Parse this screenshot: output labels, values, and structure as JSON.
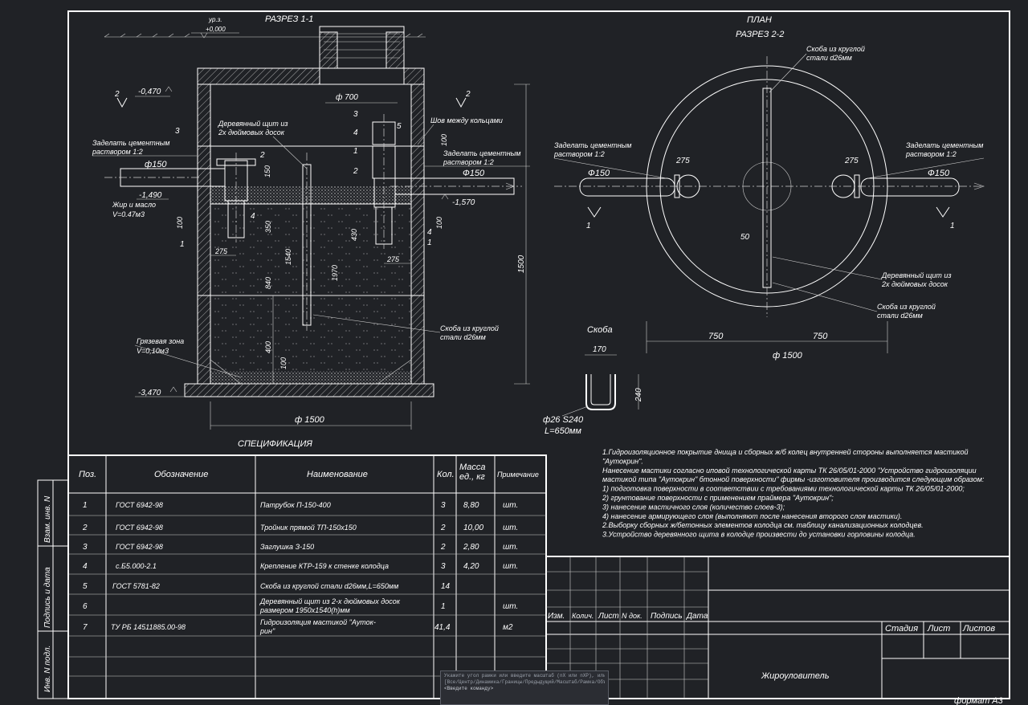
{
  "drawing": {
    "section_1_title": "РАЗРЕЗ 1-1",
    "plan_title": "ПЛАН",
    "plan_subtitle": "РАЗРЕЗ 2-2",
    "spec_title": "СПЕЦИФИКАЦИЯ",
    "clip_title": "Скоба",
    "ground_level_label": "ур.з.",
    "ground_level_value": "+0,000",
    "section1_left": {
      "mark_minus_470": "-0,470",
      "section_marker_2": "2",
      "label_3": "3",
      "cement_note": "Заделать цементным\nраствором 1:2",
      "label_2": "2",
      "dim_150": "150",
      "pipe_d150": "ф150",
      "mark_minus_1490": "-1,490",
      "grease_note": "Жир и масло",
      "grease_volume": "V=0.47м3",
      "label_4": "4",
      "dim_100": "100",
      "dim_350": "350",
      "label_1": "1",
      "dim_275": "275",
      "dim_840": "840",
      "dim_1540": "1540",
      "dim_400": "400",
      "dim_100b": "100",
      "mud_zone": "Грязевая зона",
      "mud_volume": "V=0,10м3",
      "mark_minus_3470": "-3,470",
      "dim_d1500": "ф 1500",
      "wood_shield": "Деревянный щит из\n2х дюймовых досок",
      "dim_d700": "ф 700"
    },
    "section1_right": {
      "label_3": "3",
      "label_5": "5",
      "label_4": "4",
      "label_1": "1",
      "label_2": "2",
      "section_marker_2": "2",
      "ring_seam": "Шов между кольцами",
      "dim_100": "100",
      "cement_note": "Заделать цементным\nраствором 1:2",
      "pipe_d150": "Ф150",
      "mark_minus_1570": "-1,570",
      "dim_430": "430",
      "dim_1970": "1970",
      "dim_100b": "100",
      "label_4b": "4",
      "label_1b": "1",
      "dim_275": "275",
      "dim_1500": "1500",
      "clip_note": "Скоба из круглой\nстали d26мм"
    },
    "plan": {
      "clip_note_top": "Скоба из круглой\nстали d26мм",
      "cement_left": "Заделать цементным\nраствором 1:2",
      "cement_right": "Заделать цементным\nраствором 1:2",
      "dim_275_left": "275",
      "dim_275_right": "275",
      "pipe_left": "Ф150",
      "pipe_right": "Ф150",
      "marker_1_left": "1",
      "marker_1_right": "1",
      "dim_50": "50",
      "wood_shield": "Деревянный щит из\n2х дюймовых досок",
      "clip_note_bottom": "Скоба из круглой\nстали d26мм",
      "dim_750_left": "750",
      "dim_750_right": "750",
      "dim_d1500": "ф 1500"
    },
    "clip": {
      "dim_170": "170",
      "dim_240": "240",
      "steel": "ф26 S240",
      "length": "L=650мм"
    }
  },
  "spec_table": {
    "headers": [
      "Поз.",
      "Обозначение",
      "Наименование",
      "Кол.",
      "Масса\nед., кг",
      "Примечание"
    ],
    "rows": [
      {
        "pos": "1",
        "code": "ГОСТ 6942-98",
        "name": "Патрубок П-150-400",
        "qty": "3",
        "mass": "8,80",
        "note": "шт."
      },
      {
        "pos": "2",
        "code": "ГОСТ 6942-98",
        "name": "Тройник прямой ТП-150х150",
        "qty": "2",
        "mass": "10,00",
        "note": "шт."
      },
      {
        "pos": "3",
        "code": "ГОСТ 6942-98",
        "name": "Заглушка З-150",
        "qty": "2",
        "mass": "2,80",
        "note": "шт."
      },
      {
        "pos": "4",
        "code": "с.Б5.000-2.1",
        "name": "Крепление КТР-159 к стенке колодца",
        "qty": "3",
        "mass": "4,20",
        "note": "шт."
      },
      {
        "pos": "5",
        "code": "ГОСТ 5781-82",
        "name": "Скоба из круглой стали d26мм,L=650мм",
        "qty": "14",
        "mass": "",
        "note": ""
      },
      {
        "pos": "6",
        "code": "",
        "name": "Деревянный щит из 2-х дюймовых досок\nразмером 1950х1540(h)мм",
        "qty": "1",
        "mass": "",
        "note": "шт."
      },
      {
        "pos": "7",
        "code": "ТУ РБ 14511885.00-98",
        "name": "Гидроизоляция мастикой \"Ауток-\nрин\"",
        "qty": "41,4",
        "mass": "",
        "note": "м2"
      }
    ]
  },
  "side_stamps": [
    "Взам. инв. N",
    "Подпись и дата",
    "Инв. N подл."
  ],
  "notes": [
    "1.Гидроизоляционное покрытие днища и сборных ж/б колец  внутренней стороны выполняется мастикой",
    "\"Аутокрин\".",
    "Нанесение мастики согласно иповой технологической карты ТК 26/05/01-2000 \"Устройство гидроизоляции",
    "мастикой типа \"Аутокрин\" бтонной поверхности\" фирмы -изготовителя производится следующим образом:",
    "1) подготовка поверхности в соответствии с требованиями технологической карты ТК 26/05/01-2000;",
    "2) грунтование поверхности  с применением праймера \"Аутокрин\";",
    "3) нанесение мастичного слоя (количество слоев-3);",
    "4) нанесение армирующего слоя (выполняют после нанесения второго слоя мастики).",
    "2.Выборку сборных ж/бетонных элементов колодца см. таблицу канализационных колодцев.",
    "3.Устройство деревянного щита в колодце произвести до установки горловины колодца."
  ],
  "title_block": {
    "columns": [
      "Изм.",
      "Колич.",
      "Лист",
      "N док.",
      "Подпись",
      "Дата"
    ],
    "stage_headers": [
      "Стадия",
      "Лист",
      "Листов"
    ],
    "object_name": "Жироуловитель",
    "format": "формат А3"
  },
  "command_line": {
    "line1": "Укажите угол рамки или введите масштаб (nX или nXP), или",
    "line2": "[Все/Центр/Динамика/Границы/Предыдущий/Масштаб/Рамка/Объект]",
    "prompt": "<Введите команду>"
  },
  "colors": {
    "background": "#202226",
    "lines": "#ffffff"
  }
}
